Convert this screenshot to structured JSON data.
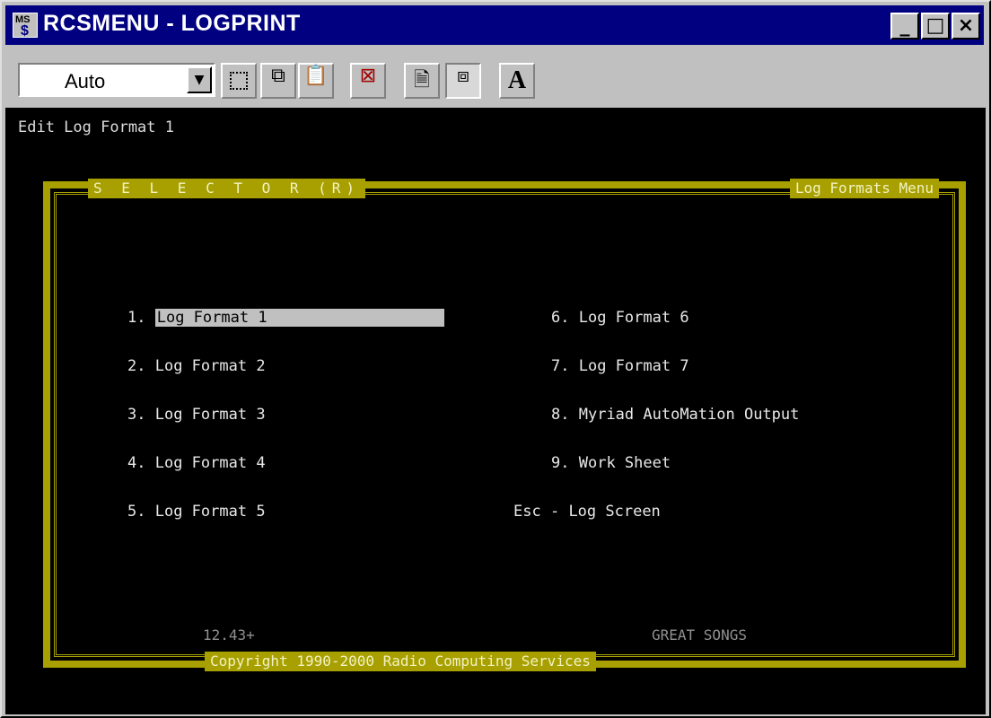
{
  "window": {
    "title": "RCSMENU - LOGPRINT",
    "icon_letters": "MS",
    "controls": {
      "minimize": "_",
      "maximize": "□",
      "close": "×"
    }
  },
  "toolbar": {
    "font_size": "Auto",
    "tools": [
      "mark-icon",
      "copy-icon",
      "paste-icon",
      "fullscreen-icon",
      "properties-icon",
      "background-icon",
      "font-icon"
    ],
    "font_label": "A"
  },
  "console": {
    "status": "Edit Log Format 1",
    "menu_title_left": "S E L E C T O R (R)",
    "menu_title_right": "Log Formats Menu",
    "left_items": [
      {
        "key": "1.",
        "label": "Log Format 1"
      },
      {
        "key": "2.",
        "label": "Log Format 2"
      },
      {
        "key": "3.",
        "label": "Log Format 3"
      },
      {
        "key": "4.",
        "label": "Log Format 4"
      },
      {
        "key": "5.",
        "label": "Log Format 5"
      }
    ],
    "right_items": [
      {
        "key": "6.",
        "label": "Log Format 6"
      },
      {
        "key": "7.",
        "label": "Log Format 7"
      },
      {
        "key": "8.",
        "label": "Myriad AutoMation Output"
      },
      {
        "key": "9.",
        "label": "Work Sheet"
      },
      {
        "key": "Esc -",
        "label": "Log Screen"
      }
    ],
    "version": "12.43+",
    "station": "GREAT SONGS",
    "copyright": "Copyright 1990-2000 Radio Computing Services"
  }
}
